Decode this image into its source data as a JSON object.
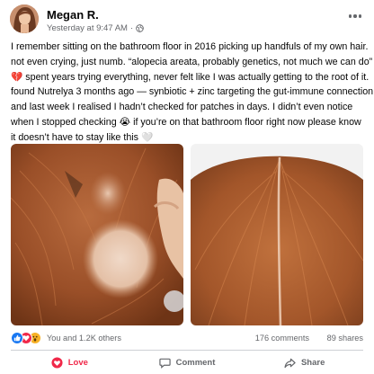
{
  "post": {
    "author": "Megan R.",
    "timestamp": "Yesterday at 9:47 AM",
    "separator": "·",
    "privacy_icon": "globe-icon",
    "text_lines": [
      "I remember sitting on the bathroom floor in 2016 picking up handfuls of my own hair.",
      "not even crying, just numb. “alopecia areata, probably genetics, not much we can do”",
      "💔 spent years trying everything, never felt like I was actually getting to the root of it.",
      "found Nutrelya 3 months ago — synbiotic + zinc targeting the gut-immune connection,",
      "and last week I realised I hadn’t checked for patches in days. I didn’t even notice",
      "when I stopped checking 😭 if you’re on that bathroom floor right now please know",
      "it doesn’t have to stay like this 🤍"
    ]
  },
  "stats": {
    "reactions_text": "You and 1.2K others",
    "comments": "176 comments",
    "shares": "89 shares"
  },
  "actions": {
    "love": "Love",
    "comment": "Comment",
    "share": "Share"
  },
  "colors": {
    "like_blue": "#1877f2",
    "love_red": "#f02849",
    "wow_yellow": "#f7b125",
    "secondary_text": "#65676b",
    "divider": "#ced0d4"
  }
}
